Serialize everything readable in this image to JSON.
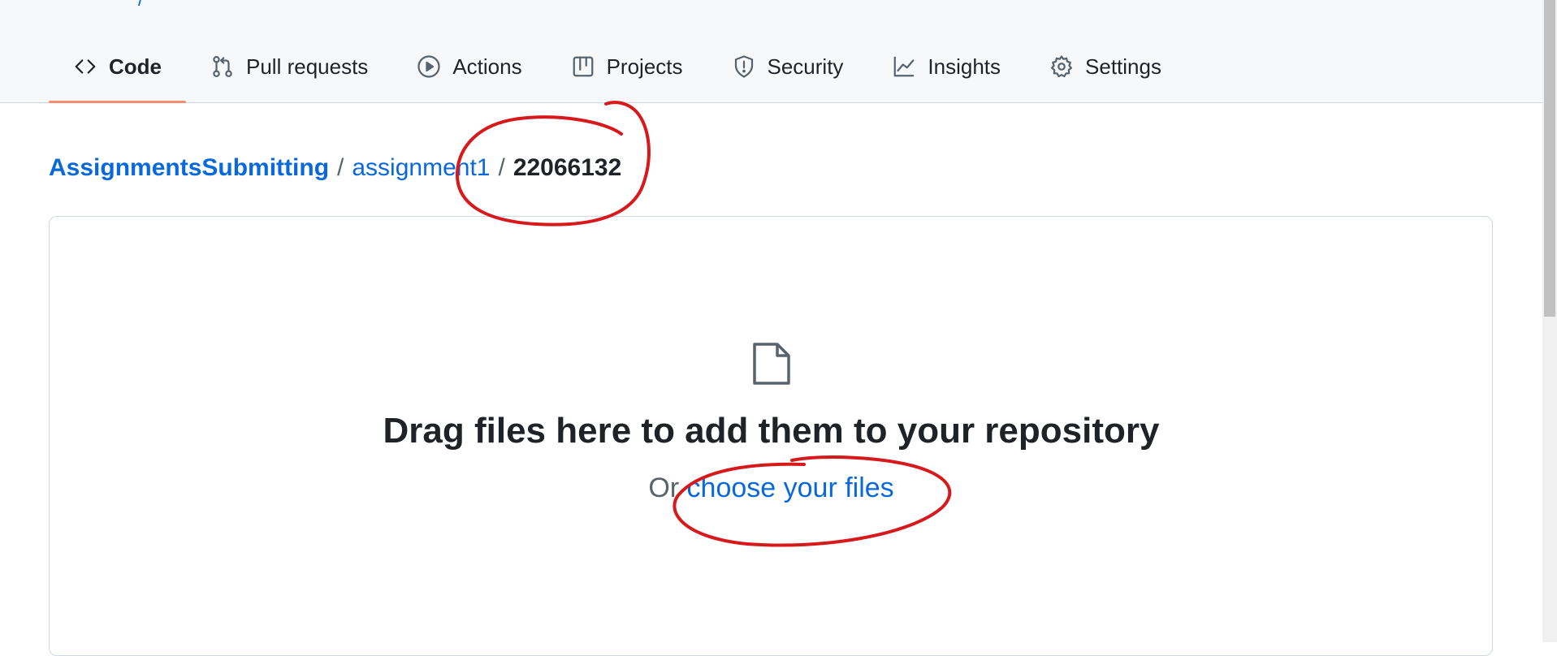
{
  "tabs": [
    {
      "label": "Code",
      "icon": "code-icon",
      "active": true
    },
    {
      "label": "Pull requests",
      "icon": "pull-request-icon"
    },
    {
      "label": "Actions",
      "icon": "play-icon"
    },
    {
      "label": "Projects",
      "icon": "table-icon"
    },
    {
      "label": "Security",
      "icon": "shield-icon"
    },
    {
      "label": "Insights",
      "icon": "graph-icon"
    },
    {
      "label": "Settings",
      "icon": "gear-icon"
    }
  ],
  "breadcrumb": {
    "owner": "AssignmentsSubmitting",
    "separator": "/",
    "repo": "assignment1",
    "current": "22066132"
  },
  "dropzone": {
    "icon": "file-icon",
    "title": "Drag files here to add them to your repository",
    "prefix": "Or",
    "link": "choose your files"
  },
  "colors": {
    "accent": "#0969da",
    "tab_underline": "#fd8c73",
    "annotation": "#d7191c"
  }
}
